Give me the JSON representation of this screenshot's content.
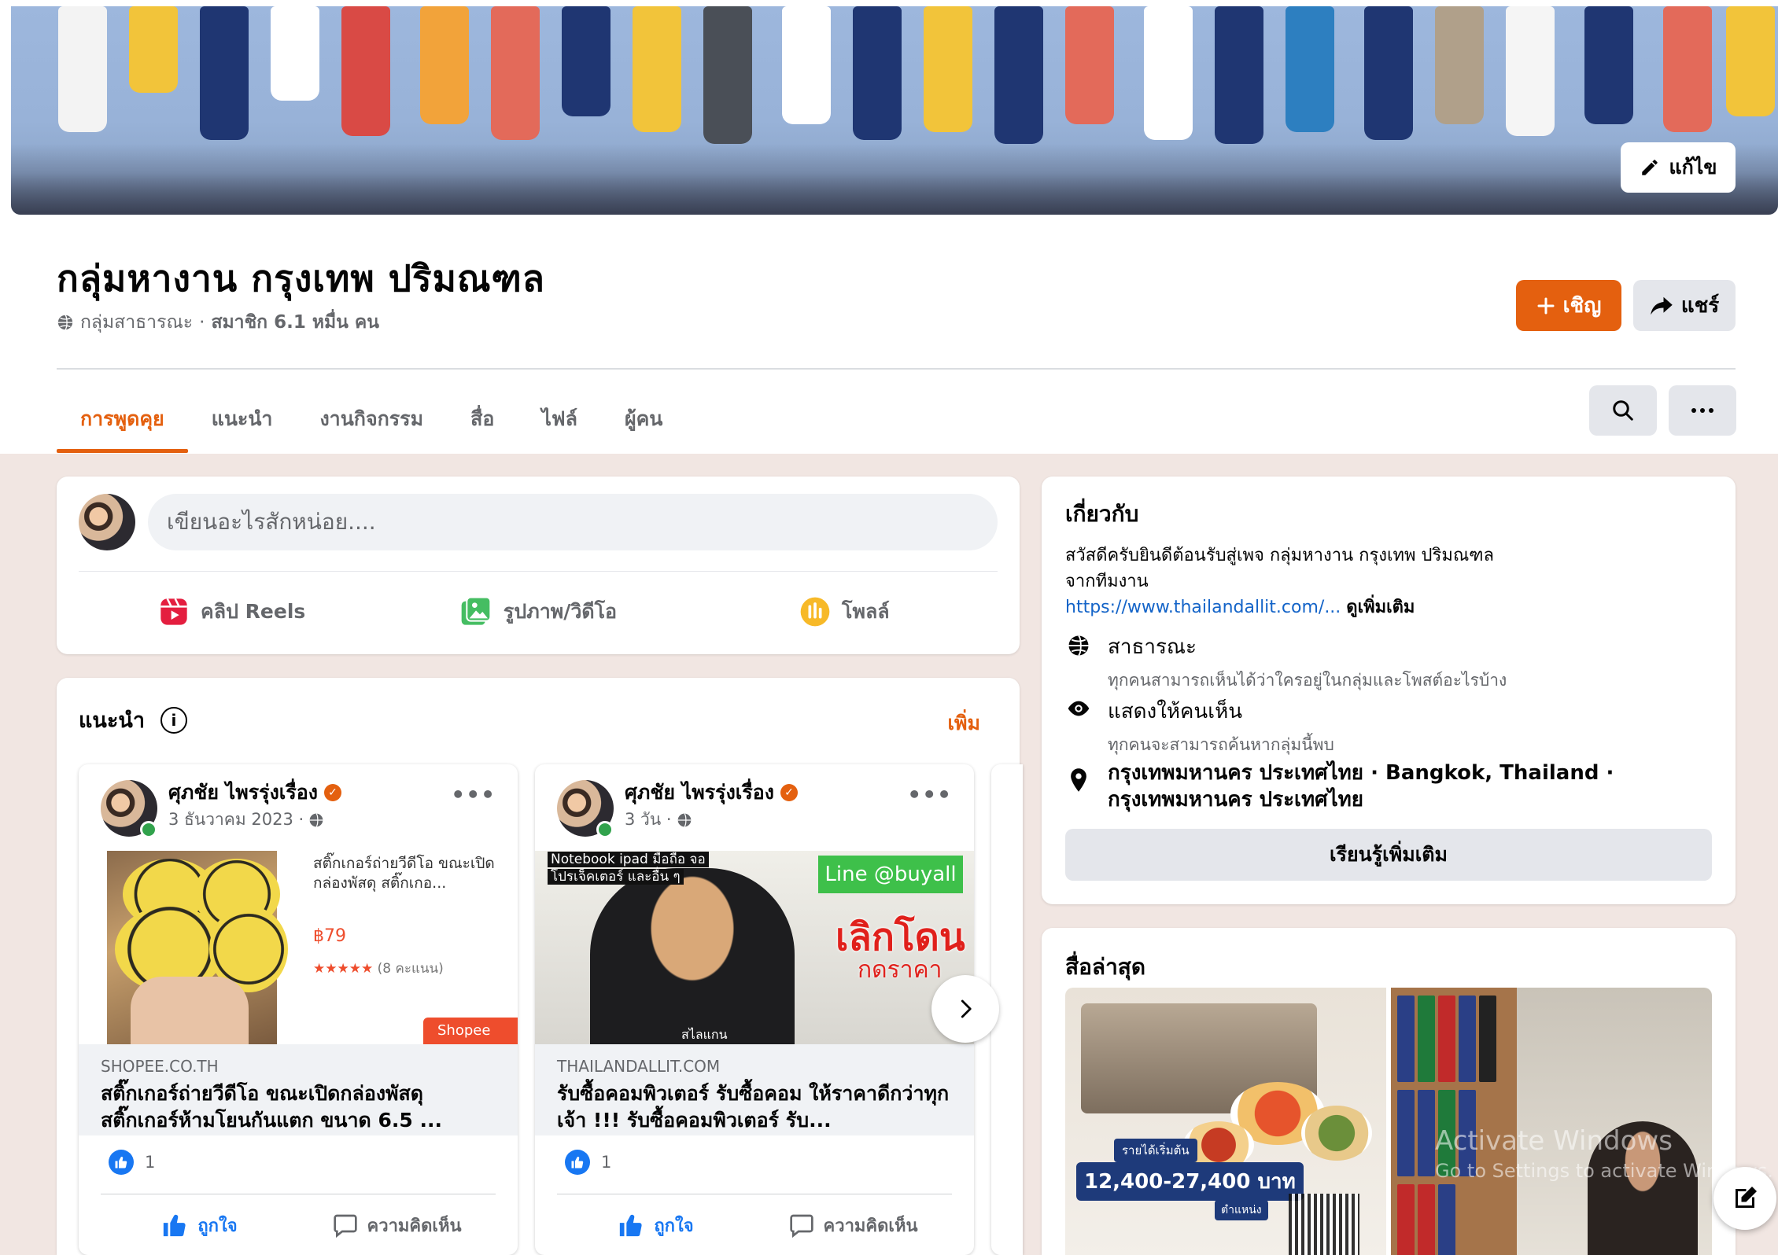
{
  "header": {
    "edit_cover_label": "แก้ไข",
    "group_name": "กลุ่มหางาน กรุงเทพ ปริมณฑล",
    "privacy": "กลุ่มสาธารณะ",
    "separator": "·",
    "members": "สมาชิก 6.1 หมื่น คน",
    "invite_label": "เชิญ",
    "share_label": "แชร์"
  },
  "tabs": [
    {
      "label": "การพูดคุย",
      "active": true
    },
    {
      "label": "แนะนำ"
    },
    {
      "label": "งานกิจกรรม"
    },
    {
      "label": "สื่อ"
    },
    {
      "label": "ไฟล์"
    },
    {
      "label": "ผู้คน"
    }
  ],
  "composer": {
    "placeholder": "เขียนอะไรสักหน่อย....",
    "actions": [
      {
        "label": "คลิป Reels",
        "icon": "reels-icon",
        "color": "#e41e3f"
      },
      {
        "label": "รูปภาพ/วิดีโอ",
        "icon": "photo-icon",
        "color": "#45bd62"
      },
      {
        "label": "โพลล์",
        "icon": "poll-icon",
        "color": "#f7b928"
      }
    ]
  },
  "featured": {
    "title": "แนะนำ",
    "more_label": "เพิ่ม",
    "posts": [
      {
        "author": "ศุภชัย ไพรรุ่งเรื่อง",
        "time": "3 ธันวาคม 2023 ·",
        "shopee_text": "สติ๊กเกอร์ถ่ายวีดีโอ ขณะเปิดกล่องพัสดุ สติ๊กเกอ...",
        "shopee_price": "฿79",
        "shopee_stars": "★★★★★",
        "shopee_rating": "(8 คะแนน)",
        "shopee_logo": "Shopee",
        "domain": "SHOPEE.CO.TH",
        "link_title": "สติ๊กเกอร์ถ่ายวีดีโอ ขณะเปิดกล่องพัสดุ สติ๊กเกอร์ห้ามโยนกันแตก ขนาด 6.5 ...",
        "likes": "1",
        "like_label": "ถูกใจ",
        "comment_label": "ความคิดเห็น"
      },
      {
        "author": "ศุภชัย ไพรรุ่งเรื่อง",
        "time": "3 วัน ·",
        "media_tag_1": "Notebook ipad มือถือ จอ",
        "media_tag_2": "โปรเจ็คเตอร์ และอื่น ๆ",
        "media_line": "Line @buyall",
        "media_big": "เลิกโดน",
        "media_small": "กดราคา",
        "media_bottom": "สไลแกน",
        "domain": "THAILANDALLIT.COM",
        "link_title": "รับซื้อคอมพิวเตอร์ รับซื้อคอม ให้ราคาดีกว่าทุกเจ้า !!! รับซื้อคอมพิวเตอร์ รับ...",
        "likes": "1",
        "like_label": "ถูกใจ",
        "comment_label": "ความคิดเห็น"
      }
    ]
  },
  "about": {
    "title": "เกี่ยวกับ",
    "desc_1": "สวัสดีครับยินดีต้อนรับสู่เพจ กลุ่มหางาน กรุงเทพ ปริมณฑล",
    "desc_2": "จากทีมงาน",
    "link": "https://www.thailandallit.com/...",
    "see_more": "ดูเพิ่มเติม",
    "public_title": "สาธารณะ",
    "public_desc": "ทุกคนสามารถเห็นได้ว่าใครอยู่ในกลุ่มและโพสต์อะไรบ้าง",
    "visible_title": "แสดงให้คนเห็น",
    "visible_desc": "ทุกคนจะสามารถค้นหากลุ่มนี้พบ",
    "location_1": "กรุงเทพมหานคร ประเทศไทย · Bangkok, Thailand ·",
    "location_2": "กรุงเทพมหานคร ประเทศไทย",
    "learn_more": "เรียนรู้เพิ่มเติม"
  },
  "recent_media": {
    "title": "สื่อล่าสุด",
    "thumb1_label": "รายได้เริ่มต้น",
    "thumb1_salary": "12,400-27,400 บาท",
    "thumb1_position": "ตำแหน่ง"
  },
  "watermark": {
    "line1": "Activate Windows",
    "line2": "Go to Settings to activate Windows."
  },
  "colors": {
    "accent": "#e4600f",
    "like_blue": "#1877f2",
    "link_blue": "#1464c8"
  }
}
